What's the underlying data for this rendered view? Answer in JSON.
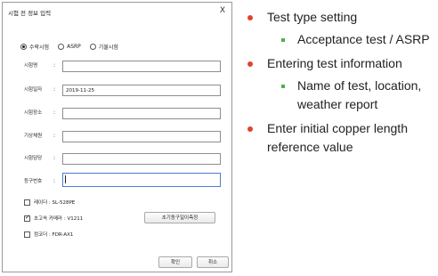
{
  "dialog": {
    "title": "시험 전 정보 입력",
    "close_label": "X",
    "radios": [
      {
        "label": "수락시험",
        "checked": true
      },
      {
        "label": "ASRP",
        "checked": false
      },
      {
        "label": "기물시험",
        "checked": false
      }
    ],
    "fields": [
      {
        "label": "시험명",
        "colon": ":",
        "value": ""
      },
      {
        "label": "시험일자",
        "colon": ":",
        "value": "2019-11-25"
      },
      {
        "label": "시험장소",
        "colon": ":",
        "value": ""
      },
      {
        "label": "기상체원",
        "colon": ":",
        "value": ""
      },
      {
        "label": "시험담당",
        "colon": ":",
        "value": ""
      },
      {
        "label": "등구번호",
        "colon": ":",
        "value": ""
      }
    ],
    "checks": [
      {
        "label": "레이더 : SL-528PE",
        "checked": false
      },
      {
        "label": "초고속 카메라 : V1211",
        "checked": true
      },
      {
        "label": "컴코더 : FDR-AX1",
        "checked": false
      }
    ],
    "measure_button": "초기동구일이측정",
    "ok_button": "확인",
    "cancel_button": "취소"
  },
  "notes": {
    "bullets": [
      {
        "text": "Test type setting",
        "sub": [
          "Acceptance test / ASRP"
        ]
      },
      {
        "text": "Entering test information",
        "sub": [
          "Name of test, location,",
          "weather report"
        ]
      },
      {
        "text": "Enter initial copper length",
        "cont": "reference value"
      }
    ]
  },
  "colors": {
    "bullet_red": "#e0432f",
    "bullet_green": "#4fb04a",
    "active_border": "#4a7fd6"
  }
}
